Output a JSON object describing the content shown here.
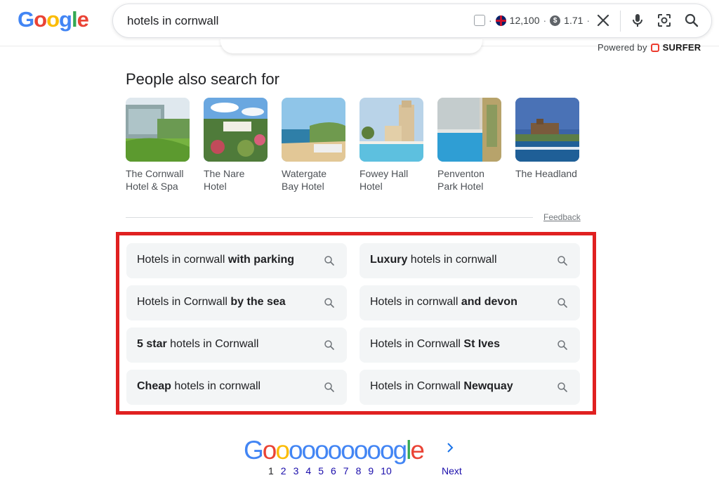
{
  "logo": {
    "letters": [
      "G",
      "o",
      "o",
      "g",
      "l",
      "e"
    ],
    "colors": [
      "#4285f4",
      "#ea4335",
      "#fbbc05",
      "#4285f4",
      "#34a853",
      "#ea4335"
    ]
  },
  "search": {
    "query": "hotels in cornwall",
    "volume": "12,100",
    "cpc": "1.71",
    "dot": "·"
  },
  "powered_by": {
    "label": "Powered by",
    "brand": "SURFER"
  },
  "people_also_search": {
    "title": "People also search for",
    "items": [
      {
        "line1": "The Cornwall",
        "line2": "Hotel & Spa"
      },
      {
        "line1": "The Nare",
        "line2": "Hotel"
      },
      {
        "line1": "Watergate",
        "line2": "Bay Hotel"
      },
      {
        "line1": "Fowey Hall",
        "line2": "Hotel"
      },
      {
        "line1": "Penventon",
        "line2": "Park Hotel"
      },
      {
        "line1": "The Headland",
        "line2": ""
      }
    ],
    "feedback": "Feedback"
  },
  "related": [
    {
      "pre": "Hotels in cornwall ",
      "bold": "with parking",
      "post": ""
    },
    {
      "pre": "",
      "bold": "Luxury",
      "post": " hotels in cornwall"
    },
    {
      "pre": "Hotels in Cornwall ",
      "bold": "by the sea",
      "post": ""
    },
    {
      "pre": "Hotels in cornwall ",
      "bold": "and devon",
      "post": ""
    },
    {
      "pre": "",
      "bold": "5 star",
      "post": " hotels in Cornwall"
    },
    {
      "pre": "Hotels in Cornwall ",
      "bold": "St Ives",
      "post": ""
    },
    {
      "pre": "",
      "bold": "Cheap",
      "post": " hotels in cornwall"
    },
    {
      "pre": "Hotels in Cornwall ",
      "bold": "Newquay",
      "post": ""
    }
  ],
  "pagination": {
    "pages": [
      "1",
      "2",
      "3",
      "4",
      "5",
      "6",
      "7",
      "8",
      "9",
      "10"
    ],
    "current": "1",
    "next": "Next",
    "wordmark": "Goooooooooogle",
    "wordmark_colors": [
      "#4285f4",
      "#ea4335",
      "#fbbc05",
      "#4285f4",
      "#4285f4",
      "#4285f4",
      "#4285f4",
      "#4285f4",
      "#4285f4",
      "#4285f4",
      "#4285f4",
      "#4285f4",
      "#34a853",
      "#ea4335"
    ]
  },
  "colors": {
    "highlight_frame": "#e02020",
    "link": "#1a0dab"
  }
}
